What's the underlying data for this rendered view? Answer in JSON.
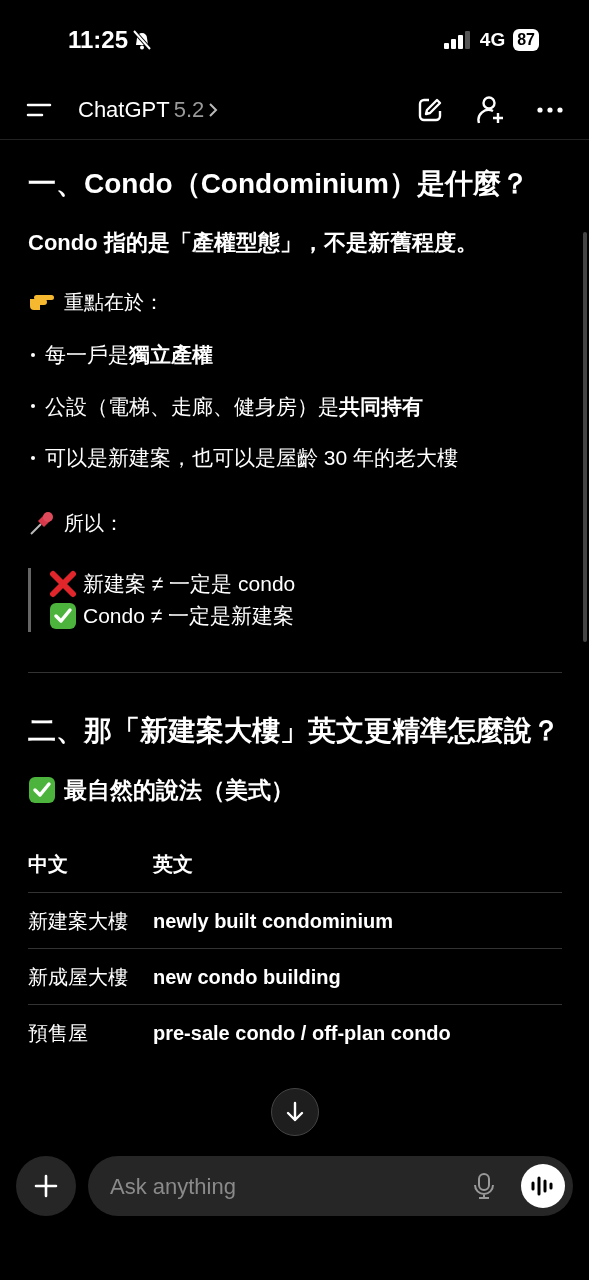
{
  "status_bar": {
    "time": "11:25",
    "network": "4G",
    "battery": "87"
  },
  "header": {
    "title": "ChatGPT",
    "version": "5.2"
  },
  "content": [
    {
      "kind": "heading",
      "text": "一、Condo（Condominium）是什麼？"
    },
    {
      "kind": "lead",
      "text": "Condo 指的是「產權型態」，不是新舊程度。"
    },
    {
      "kind": "pointer-note",
      "text": "重點在於："
    },
    {
      "kind": "bullets",
      "items": [
        "每一戶是**獨立產權**",
        "公設（電梯、走廊、健身房）是**共同持有**",
        "可以是新建案，也可以是屋齡 30 年的老大樓"
      ]
    },
    {
      "kind": "pin-note",
      "text": "所以："
    },
    {
      "kind": "quote",
      "lines": [
        {
          "kind": "wrong",
          "text": "新建案 ≠ 一定是 condo"
        },
        {
          "kind": "right",
          "text": "Condo ≠ 一定是新建案"
        }
      ]
    },
    {
      "kind": "rule"
    },
    {
      "kind": "heading",
      "text": "二、那「新建案大樓」英文更精準怎麼說？"
    },
    {
      "kind": "checked-subheading",
      "text": "最自然的說法（美式）"
    },
    {
      "kind": "table",
      "columns": [
        "中文",
        "英文"
      ],
      "rows": [
        [
          "新建案大樓",
          "newly built condominium"
        ],
        [
          "新成屋大樓",
          "new condo building"
        ],
        [
          "預售屋",
          "pre-sale condo / off-plan condo"
        ]
      ]
    }
  ],
  "composer": {
    "placeholder": "Ask anything"
  }
}
